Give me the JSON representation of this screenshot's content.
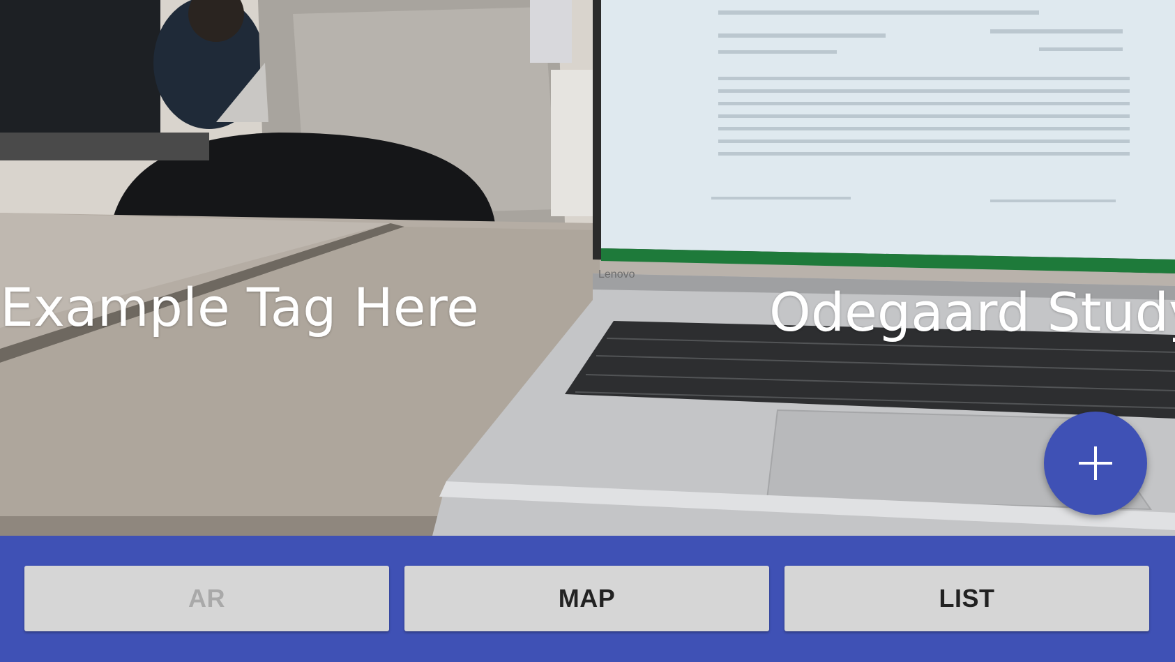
{
  "camera_view": {
    "laptop_brand": "Lenovo"
  },
  "ar_tags": [
    {
      "label": "Example Tag Here"
    },
    {
      "label": "Odegaard Study B"
    }
  ],
  "fab": {
    "icon": "plus-icon"
  },
  "bottom_nav": {
    "buttons": [
      {
        "label": "AR",
        "enabled": false
      },
      {
        "label": "MAP",
        "enabled": true
      },
      {
        "label": "LIST",
        "enabled": true
      }
    ]
  },
  "colors": {
    "primary": "#3f51b5",
    "button_bg": "#d6d6d6",
    "button_text": "#222222",
    "button_disabled_text": "#a9a9a9"
  }
}
